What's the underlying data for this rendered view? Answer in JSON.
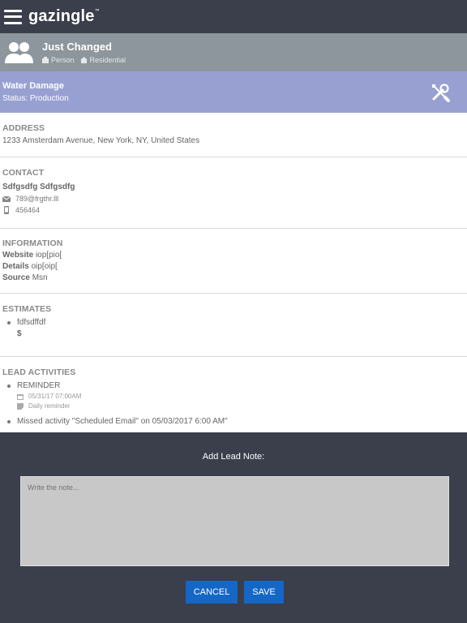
{
  "app": {
    "logo": "gazingle",
    "logo_mark": "™"
  },
  "person": {
    "name": "Just Changed",
    "type": "Person",
    "category": "Residential"
  },
  "job": {
    "title": "Water Damage",
    "status": "Status: Production"
  },
  "address": {
    "heading": "ADDRESS",
    "value": "1233 Amsterdam Avenue, New York, NY, United States"
  },
  "contact": {
    "heading": "CONTACT",
    "name": "Sdfgsdfg Sdfgsdfg",
    "email": "789@frgthr.lll",
    "phone": "456464"
  },
  "information": {
    "heading": "INFORMATION",
    "rows": [
      {
        "label": "Website",
        "value": "iop[pio["
      },
      {
        "label": "Details",
        "value": "oip[oip["
      },
      {
        "label": "Source",
        "value": "Msn"
      }
    ]
  },
  "estimates": {
    "heading": "ESTIMATES",
    "items": [
      {
        "name": "fdfsdffdf",
        "amount": "$"
      }
    ]
  },
  "activities": {
    "heading": "LEAD ACTIVITIES",
    "items": [
      {
        "title": "REMINDER",
        "date": "05/31/17 07:00AM",
        "note": "Daily reminder"
      },
      {
        "title": "Missed activity \"Scheduled Email\" on 05/03/2017 6:00 AM\""
      }
    ]
  },
  "note_panel": {
    "title": "Add Lead Note:",
    "placeholder": "Write the note...",
    "cancel": "CANCEL",
    "save": "SAVE"
  },
  "colors": {
    "topbar": "#3a3f4b",
    "person_bar": "#8c969c",
    "job_bar": "#98a0d2",
    "button": "#1467c6",
    "note_bg": "#c8c8c8"
  }
}
